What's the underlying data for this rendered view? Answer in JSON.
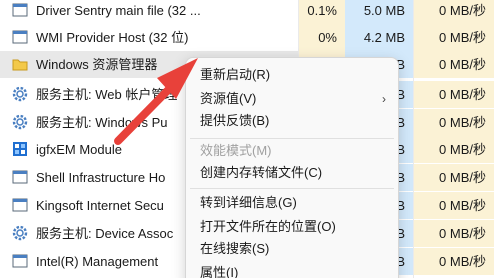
{
  "processes": [
    {
      "name": "Driver Sentry main file (32 ...",
      "cpu": "0.1%",
      "memory": "5.0 MB",
      "disk": "0 MB/秒",
      "icon": "app-window-icon"
    },
    {
      "name": "WMI Provider Host (32 位)",
      "cpu": "0%",
      "memory": "4.2 MB",
      "disk": "0 MB/秒",
      "icon": "app-window-icon"
    },
    {
      "name": "Windows 资源管理器",
      "cpu": "",
      "memory": "B",
      "disk": "0 MB/秒",
      "icon": "folder-icon"
    },
    {
      "name": "服务主机: Web 帐户管理",
      "cpu": "",
      "memory": "B",
      "disk": "0 MB/秒",
      "icon": "gear-icon"
    },
    {
      "name": "服务主机: Windows Pu",
      "cpu": "",
      "memory": "B",
      "disk": "0 MB/秒",
      "icon": "gear-icon"
    },
    {
      "name": "igfxEM Module",
      "cpu": "",
      "memory": "B",
      "disk": "0 MB/秒",
      "icon": "intel-graphics-icon"
    },
    {
      "name": "Shell Infrastructure Ho",
      "cpu": "",
      "memory": "B",
      "disk": "0 MB/秒",
      "icon": "app-window-icon"
    },
    {
      "name": "Kingsoft Internet Secu",
      "cpu": "",
      "memory": "B",
      "disk": "0 MB/秒",
      "icon": "app-window-icon"
    },
    {
      "name": "服务主机: Device Assoc",
      "cpu": "",
      "memory": "B",
      "disk": "0 MB/秒",
      "icon": "gear-icon"
    },
    {
      "name": "Intel(R) Management",
      "cpu": "",
      "memory": "B",
      "disk": "0 MB/秒",
      "icon": "app-window-icon"
    }
  ],
  "context_menu": {
    "items": [
      {
        "label": "重新启动(R)",
        "enabled": true
      },
      {
        "label": "资源值(V)",
        "enabled": true,
        "submenu": true
      },
      {
        "label": "提供反馈(B)",
        "enabled": true
      },
      {
        "label": "效能模式(M)",
        "enabled": false
      },
      {
        "label": "创建内存转储文件(C)",
        "enabled": true
      },
      {
        "label": "转到详细信息(G)",
        "enabled": true
      },
      {
        "label": "打开文件所在的位置(O)",
        "enabled": true
      },
      {
        "label": "在线搜索(S)",
        "enabled": true
      },
      {
        "label": "属性(I)",
        "enabled": true
      }
    ],
    "submenu_glyph": "›"
  },
  "colors": {
    "cpu_column_bg": "#fbf2d5",
    "memory_column_bg": "#d3e9fb",
    "disk_column_bg": "#fbf2d5",
    "annotation_arrow": "#e8413a",
    "selected_row_bg": "#e8e8e8"
  }
}
